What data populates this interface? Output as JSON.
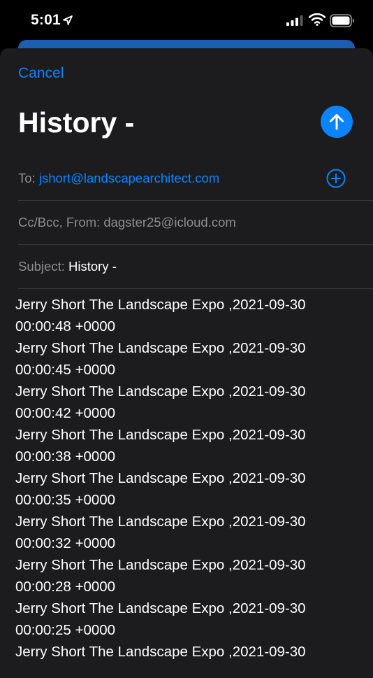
{
  "status": {
    "time": "5:01"
  },
  "compose": {
    "cancel_label": "Cancel",
    "title": "History -",
    "to_label": "To:",
    "to_value": "jshort@landscapearchitect.com",
    "cc_label": "Cc/Bcc, From:",
    "cc_value": "dagster25@icloud.com",
    "subject_label": "Subject:",
    "subject_value": "History -"
  },
  "entries": [
    {
      "line1": "Jerry Short The Landscape Expo ,2021-09-30",
      "line2": "00:00:48 +0000"
    },
    {
      "line1": "Jerry Short The Landscape Expo ,2021-09-30",
      "line2": "00:00:45 +0000"
    },
    {
      "line1": "Jerry Short The Landscape Expo ,2021-09-30",
      "line2": "00:00:42 +0000"
    },
    {
      "line1": "Jerry Short The Landscape Expo ,2021-09-30",
      "line2": "00:00:38 +0000"
    },
    {
      "line1": "Jerry Short The Landscape Expo ,2021-09-30",
      "line2": "00:00:35 +0000"
    },
    {
      "line1": "Jerry Short The Landscape Expo ,2021-09-30",
      "line2": "00:00:32 +0000"
    },
    {
      "line1": "Jerry Short The Landscape Expo ,2021-09-30",
      "line2": "00:00:28 +0000"
    },
    {
      "line1": "Jerry Short The Landscape Expo ,2021-09-30",
      "line2": "00:00:25 +0000"
    },
    {
      "line1": "Jerry Short The Landscape Expo ,2021-09-30",
      "line2": ""
    }
  ],
  "colors": {
    "accent": "#0a84ff",
    "sheet": "#1c1c1e",
    "background": "#000000"
  },
  "icons": [
    "location-arrow-icon",
    "cellular-signal-icon",
    "wifi-icon",
    "battery-icon",
    "send-arrow-icon",
    "add-contact-icon"
  ]
}
